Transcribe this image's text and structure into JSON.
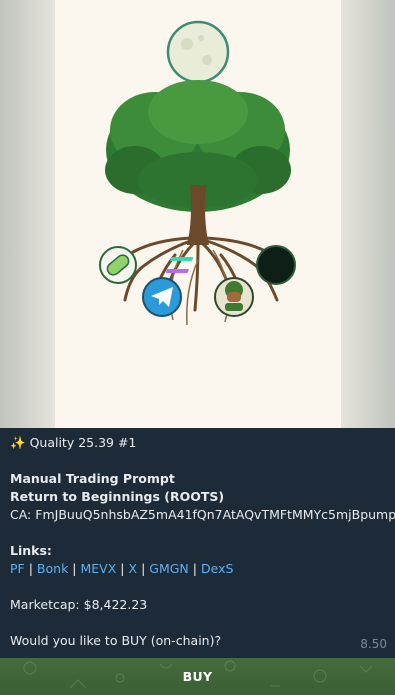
{
  "message": {
    "quality_line": "Quality 25.39 #1",
    "sparkle_icon": "sparkles-icon",
    "title": "Manual Trading Prompt",
    "token": "Return to Beginnings (ROOTS)",
    "ca_label": "CA:",
    "ca_value": "FmJBuuQ5nhsbAZ5mA41fQn7AtAQvTMFtMMYc5mjBpump",
    "links_label": "Links:",
    "links": [
      "PF",
      "Bonk",
      "MEVX",
      "X",
      "GMGN",
      "DexS"
    ],
    "separator": "|",
    "marketcap": "Marketcap: $8,422.23",
    "question": "Would you like to BUY (on-chain)?",
    "time": "8.50"
  },
  "button": {
    "label": "BUY"
  },
  "colors": {
    "bubble": "#1d2a38",
    "link": "#5fb0ec",
    "button": "#466b3c"
  }
}
